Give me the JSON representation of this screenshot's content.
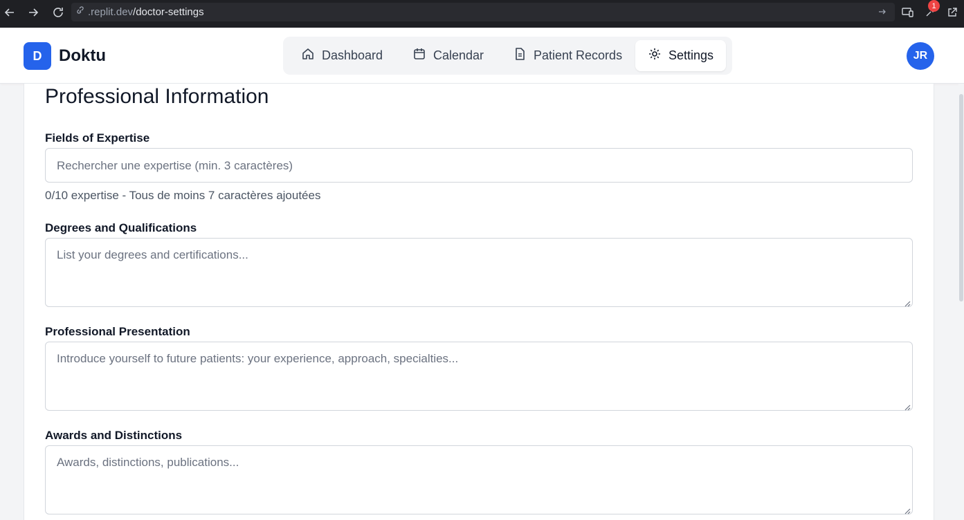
{
  "browser": {
    "url_prefix": ".replit.dev",
    "url_path": "/doctor-settings",
    "notification_count": "1"
  },
  "app": {
    "logo_letter": "D",
    "name": "Doktu",
    "avatar_initials": "JR"
  },
  "nav": {
    "items": [
      {
        "label": "Dashboard",
        "icon": "home-icon"
      },
      {
        "label": "Calendar",
        "icon": "calendar-icon"
      },
      {
        "label": "Patient Records",
        "icon": "file-icon"
      },
      {
        "label": "Settings",
        "icon": "gear-icon",
        "active": true
      }
    ]
  },
  "form": {
    "section_title": "Professional Information",
    "expertise": {
      "label": "Fields of Expertise",
      "placeholder": "Rechercher une expertise (min. 3 caractères)",
      "hint": "0/10 expertise - Tous de moins 7 caractères ajoutées"
    },
    "degrees": {
      "label": "Degrees and Qualifications",
      "placeholder": "List your degrees and certifications..."
    },
    "presentation": {
      "label": "Professional Presentation",
      "placeholder": "Introduce yourself to future patients: your experience, approach, specialties..."
    },
    "awards": {
      "label": "Awards and Distinctions",
      "placeholder": "Awards, distinctions, publications..."
    }
  },
  "colors": {
    "primary": "#2563eb",
    "browser_bar": "#1f2024",
    "badge": "#ef4444"
  }
}
